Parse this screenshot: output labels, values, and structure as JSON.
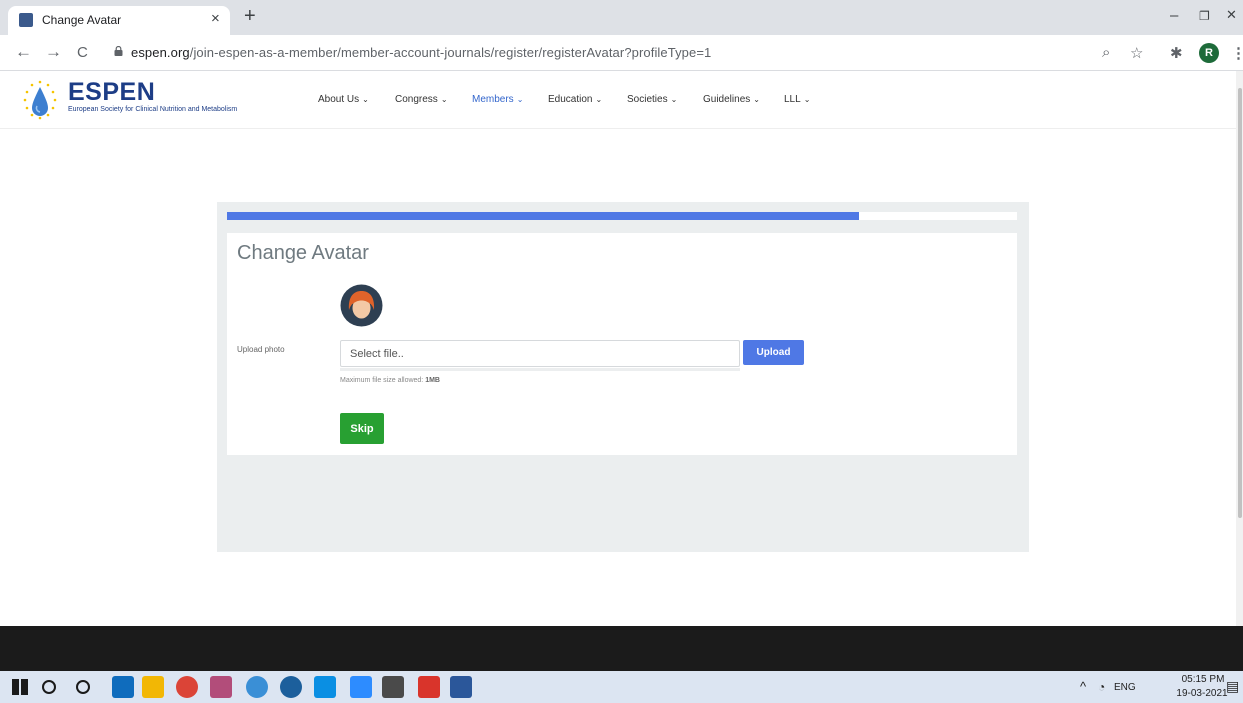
{
  "browser": {
    "tab_title": "Change Avatar",
    "tab_close": "×",
    "new_tab": "+",
    "url_host": "espen.org",
    "url_path": "/join-espen-as-a-member/member-account-journals/register/registerAvatar?profileType=1",
    "profile_initial": "R",
    "window_controls": {
      "minimize": "–",
      "restore": "❐",
      "close": "✕"
    },
    "nav": {
      "back": "←",
      "forward": "→",
      "reload": "C"
    }
  },
  "site": {
    "logo_title": "ESPEN",
    "logo_subtitle": "European Society for Clinical Nutrition and Metabolism",
    "menu": [
      {
        "label": "About Us",
        "active": false
      },
      {
        "label": "Congress",
        "active": false
      },
      {
        "label": "Members",
        "active": true
      },
      {
        "label": "Education",
        "active": false
      },
      {
        "label": "Societies",
        "active": false
      },
      {
        "label": "Guidelines",
        "active": false
      },
      {
        "label": "LLL",
        "active": false
      }
    ],
    "menu_chevron": "⌄"
  },
  "form": {
    "progress": 0.8,
    "title": "Change Avatar",
    "upload_label": "Upload photo",
    "file_placeholder": "Select file..",
    "upload_button": "Upload",
    "size_note_prefix": "Maximum file size allowed: ",
    "size_note_value": "1MB",
    "skip_button": "Skip"
  },
  "taskbar": {
    "apps": [
      {
        "name": "start",
        "color": "#1a1a1a"
      },
      {
        "name": "search",
        "color": "#1a1a1a"
      },
      {
        "name": "cortana",
        "color": "#1a1a1a"
      },
      {
        "name": "outlook",
        "color": "#0f6cbd"
      },
      {
        "name": "file-explorer",
        "color": "#f2b705"
      },
      {
        "name": "chrome",
        "color": "#db4437"
      },
      {
        "name": "snip",
        "color": "#b24d7a"
      },
      {
        "name": "app-globe",
        "color": "#3a8fd6"
      },
      {
        "name": "app-camera",
        "color": "#1c5f9c"
      },
      {
        "name": "skype",
        "color": "#0a8fe3"
      },
      {
        "name": "zoom",
        "color": "#2d8cff"
      },
      {
        "name": "calculator",
        "color": "#4a4a4a"
      },
      {
        "name": "acrobat",
        "color": "#d9342b"
      },
      {
        "name": "word",
        "color": "#2b579a"
      }
    ],
    "tray_lang": "ENG",
    "time": "05:15 PM",
    "date": "19-03-2021"
  }
}
